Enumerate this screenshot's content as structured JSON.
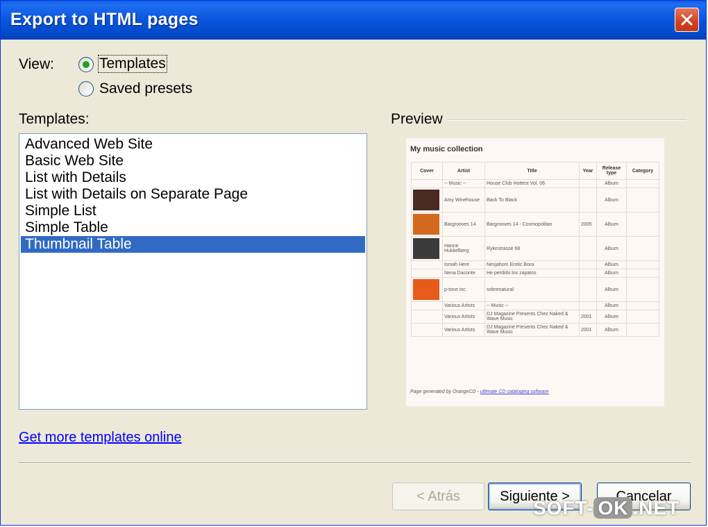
{
  "window": {
    "title": "Export to HTML pages"
  },
  "view": {
    "label": "View:",
    "options": [
      {
        "label": "Templates",
        "selected": true
      },
      {
        "label": "Saved presets",
        "selected": false
      }
    ]
  },
  "templates": {
    "label": "Templates:",
    "items": [
      "Advanced Web Site",
      "Basic Web Site",
      "List with Details",
      "List with Details on Separate Page",
      "Simple List",
      "Simple Table",
      "Thumbnail Table"
    ],
    "selected_index": 6
  },
  "preview": {
    "label": "Preview",
    "page_title": "My music collection",
    "columns": [
      "Cover",
      "Artist",
      "Title",
      "Year",
      "Release type",
      "Category"
    ],
    "rows": [
      {
        "cover": false,
        "artist": "-- Music --",
        "title": "House Club Hottest Vol. 06",
        "year": "",
        "release": "Album",
        "category": ""
      },
      {
        "cover": true,
        "cover_color": "#4a2a22",
        "artist": "Amy Winehouse",
        "title": "Back To Black",
        "year": "",
        "release": "Album",
        "category": ""
      },
      {
        "cover": true,
        "cover_color": "#d2691e",
        "artist": "Bargrooves 14",
        "title": "Bargrooves 14 - Cosmopolitan",
        "year": "2005",
        "release": "Album",
        "category": ""
      },
      {
        "cover": true,
        "cover_color": "#3a3a3a",
        "artist": "Hanne Hukkelberg",
        "title": "Rykestrasse 68",
        "year": "",
        "release": "Album",
        "category": ""
      },
      {
        "cover": false,
        "artist": "Ismah Here",
        "title": "Nesjahom Erotic Bora",
        "year": "",
        "release": "Album",
        "category": ""
      },
      {
        "cover": false,
        "artist": "Nena Daconte",
        "title": "He perdido los zapatos",
        "year": "",
        "release": "Album",
        "category": ""
      },
      {
        "cover": true,
        "cover_color": "#e85a1a",
        "artist": "p-tone inc",
        "title": "sobrenatural",
        "year": "",
        "release": "Album",
        "category": ""
      },
      {
        "cover": false,
        "artist": "Various Artists",
        "title": "-- Music --",
        "year": "",
        "release": "Album",
        "category": ""
      },
      {
        "cover": false,
        "artist": "Various Artists",
        "title": "DJ Magazine Presents Chez Naked & Wave Music",
        "year": "2001",
        "release": "Album",
        "category": ""
      },
      {
        "cover": false,
        "artist": "Various Artists",
        "title": "DJ Magazine Presents Chez Naked & Wave Music",
        "year": "2001",
        "release": "Album",
        "category": ""
      }
    ],
    "footer_text": "Page generated by OrangeCD - ",
    "footer_link": "ultimate CD cataloging software"
  },
  "get_more_link": "Get more templates online",
  "buttons": {
    "back": "< Atrás",
    "next": "Siguiente >",
    "cancel": "Cancelar"
  },
  "watermark": {
    "left": "SOFT-",
    "mid": "OK",
    "right": ".NET"
  }
}
